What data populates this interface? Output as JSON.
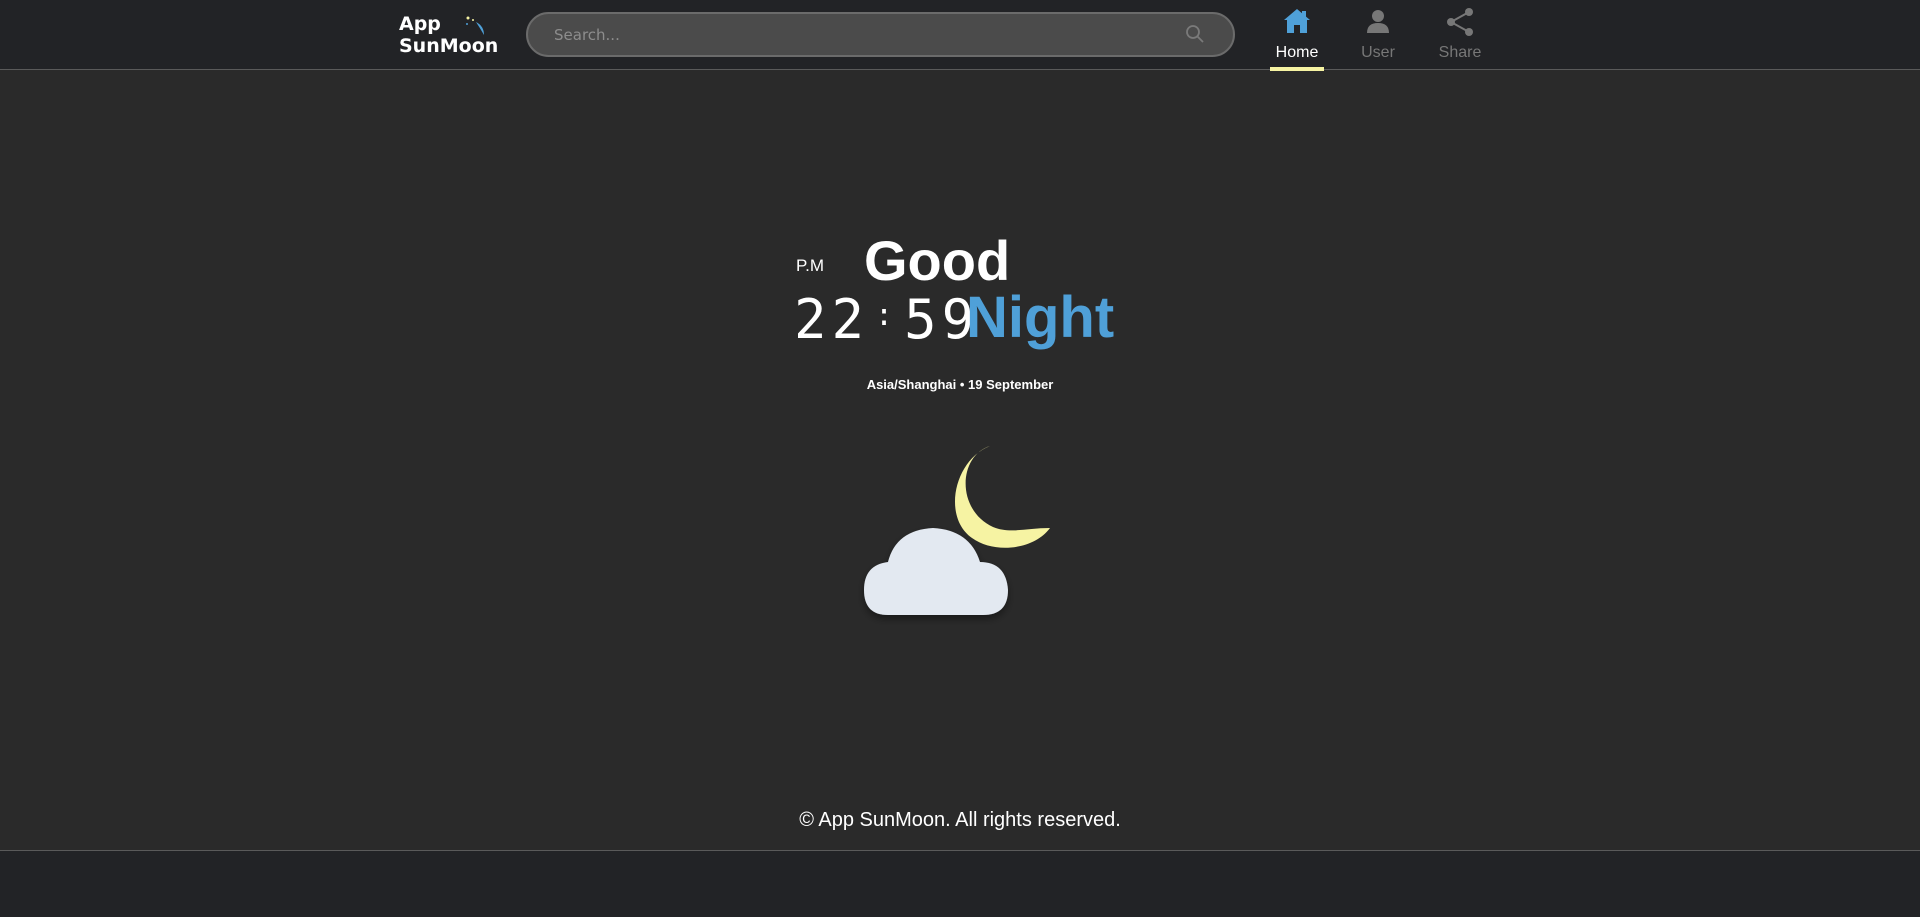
{
  "app": {
    "name_line1": "App",
    "name_line2": "SunMoon"
  },
  "search": {
    "placeholder": "Search..."
  },
  "nav": {
    "items": [
      {
        "label": "Home",
        "icon": "home-icon",
        "active": true
      },
      {
        "label": "User",
        "icon": "user-icon",
        "active": false
      },
      {
        "label": "Share",
        "icon": "share-icon",
        "active": false
      }
    ]
  },
  "greeting": {
    "period": "P.M",
    "word1": "Good",
    "word2": "Night",
    "hours": "22",
    "minutes": "59"
  },
  "location_date": "Asia/Shanghai • 19 September",
  "weather": {
    "icon": "moon-cloud-icon"
  },
  "footer": {
    "text": "© App SunMoon. All rights reserved."
  },
  "colors": {
    "accent": "#4fa0d8",
    "active_underline": "#f6f3a3",
    "moon": "#f6f3a3",
    "cloud": "#e3e9f1"
  }
}
